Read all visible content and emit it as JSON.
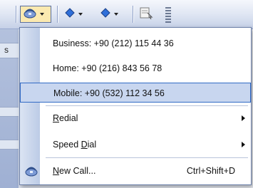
{
  "toolbar": {
    "buttons": [
      {
        "icon": "phone-dial-icon"
      },
      {
        "icon": "navigate-back-icon"
      },
      {
        "icon": "navigate-forward-icon"
      },
      {
        "icon": "address-book-icon"
      }
    ]
  },
  "left_panel": {
    "row_label": "s"
  },
  "menu": {
    "phone_items": [
      {
        "label": "Business: +90 (212) 115 44 36"
      },
      {
        "label": "Home: +90 (216) 843 56 78"
      },
      {
        "label": "Mobile: +90 (532) 112 34 56",
        "selected": true
      }
    ],
    "redial": {
      "first": "R",
      "rest": "edial"
    },
    "speed_dial": {
      "before": "Speed ",
      "first": "D",
      "rest": "ial"
    },
    "new_call": {
      "first": "N",
      "rest": "ew Call...",
      "shortcut": "Ctrl+Shift+D",
      "icon": "phone-icon"
    }
  },
  "colors": {
    "selection": "#c8d6ef",
    "selection_border": "#316ac5",
    "toolbar_pressed": "#fbe9b0"
  }
}
